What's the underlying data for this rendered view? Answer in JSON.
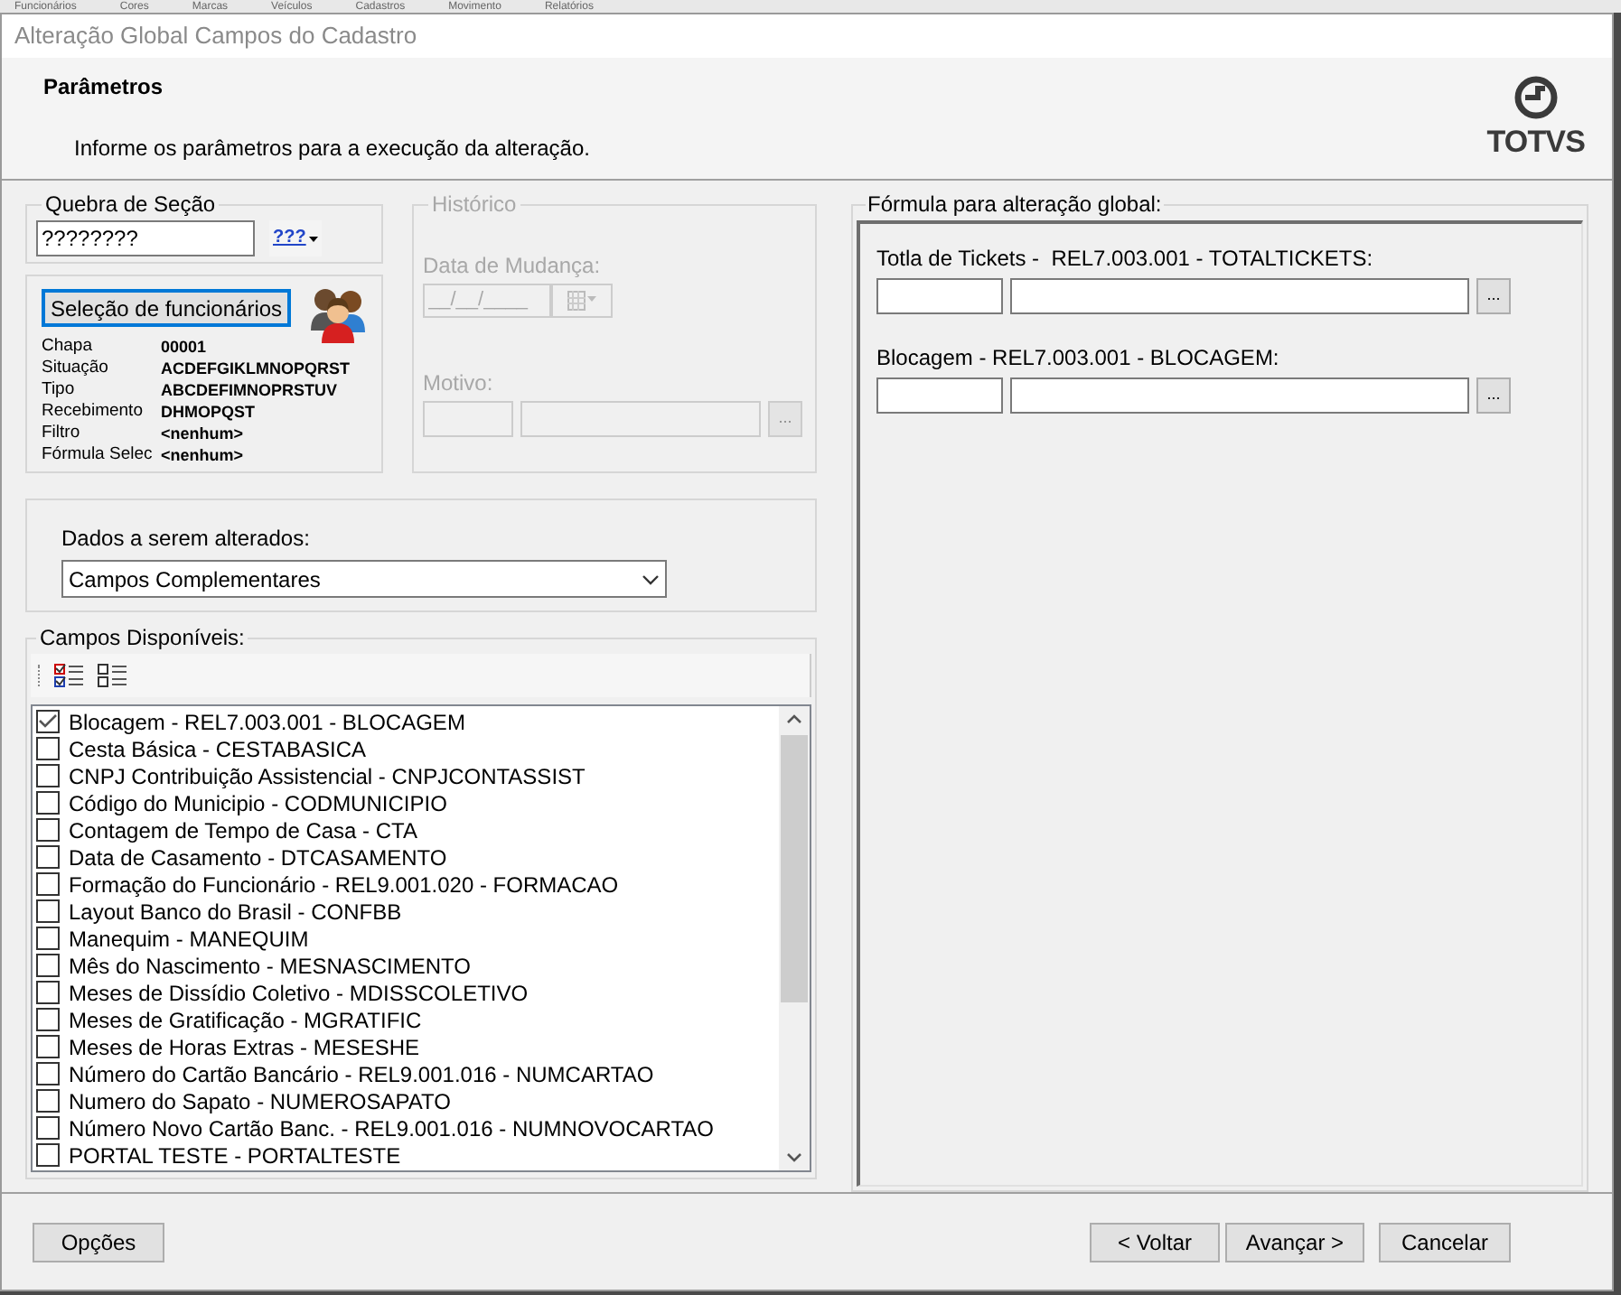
{
  "background_menu": [
    "Funcionários",
    "Cores",
    "Marcas",
    "Veículos",
    "Cadastros",
    "Movimento",
    "Relatórios"
  ],
  "window": {
    "title": "Alteração Global Campos do Cadastro"
  },
  "header": {
    "title": "Parâmetros",
    "description": "Informe os parâmetros para a execução da alteração.",
    "logo_text": "TOTVS"
  },
  "quebra_secao": {
    "label": "Quebra de Seção",
    "value": "????????",
    "picker_text": "???"
  },
  "selecao": {
    "button": "Seleção de funcionários",
    "fields": [
      {
        "label": "Chapa",
        "value": "00001"
      },
      {
        "label": "Situação",
        "value": "ACDEFGIKLMNOPQRST"
      },
      {
        "label": "Tipo",
        "value": "ABCDEFIMNOPRSTUV"
      },
      {
        "label": "Recebimento",
        "value": "DHMOPQST"
      },
      {
        "label": "Filtro",
        "value": "<nenhum>"
      },
      {
        "label": "Fórmula Selec",
        "value": "<nenhum>"
      }
    ]
  },
  "historico": {
    "label": "Histórico",
    "disabled": true,
    "date_label": "Data de Mudança:",
    "date_value": "__/__/____",
    "motivo_label": "Motivo:",
    "motivo_button": "..."
  },
  "dados": {
    "label": "Dados a serem alterados:",
    "value": "Campos Complementares"
  },
  "campos": {
    "label": "Campos Disponíveis:",
    "items": [
      {
        "label": "Blocagem - REL7.003.001 - BLOCAGEM",
        "checked": true
      },
      {
        "label": "Cesta Básica - CESTABASICA",
        "checked": false
      },
      {
        "label": "CNPJ Contribuição Assistencial - CNPJCONTASSIST",
        "checked": false
      },
      {
        "label": "Código do Municipio - CODMUNICIPIO",
        "checked": false
      },
      {
        "label": "Contagem de Tempo de Casa - CTA",
        "checked": false
      },
      {
        "label": "Data de Casamento - DTCASAMENTO",
        "checked": false
      },
      {
        "label": "Formação do Funcionário - REL9.001.020 - FORMACAO",
        "checked": false
      },
      {
        "label": "Layout Banco do Brasil - CONFBB",
        "checked": false
      },
      {
        "label": "Manequim - MANEQUIM",
        "checked": false
      },
      {
        "label": "Mês do Nascimento - MESNASCIMENTO",
        "checked": false
      },
      {
        "label": "Meses de Dissídio Coletivo - MDISSCOLETIVO",
        "checked": false
      },
      {
        "label": "Meses de Gratificação - MGRATIFIC",
        "checked": false
      },
      {
        "label": "Meses de Horas Extras - MESESHE",
        "checked": false
      },
      {
        "label": "Número do Cartão Bancário - REL9.001.016 - NUMCARTAO",
        "checked": false
      },
      {
        "label": "Numero do Sapato - NUMEROSAPATO",
        "checked": false
      },
      {
        "label": "Número Novo Cartão Banc. - REL9.001.016 - NUMNOVOCARTAO",
        "checked": false
      },
      {
        "label": "PORTAL TESTE - PORTALTESTE",
        "checked": false
      }
    ]
  },
  "formula": {
    "label": "Fórmula para alteração global:",
    "fields": [
      {
        "label": "Totla de Tickets -  REL7.003.001 - TOTALTICKETS:",
        "button": "..."
      },
      {
        "label": "Blocagem - REL7.003.001 - BLOCAGEM:",
        "button": "..."
      }
    ]
  },
  "buttons": {
    "options": "Opções",
    "back": "< Voltar",
    "next": "Avançar >",
    "cancel": "Cancelar"
  }
}
